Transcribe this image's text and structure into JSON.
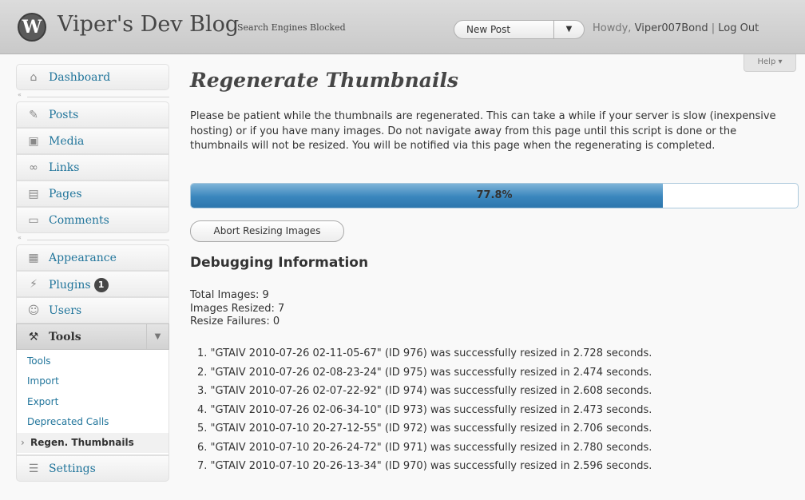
{
  "header": {
    "logo_glyph": "W",
    "site_title": "Viper's Dev Blog",
    "search_engines_notice": "Search Engines Blocked",
    "favorite_action": "New Post",
    "howdy": "Howdy,",
    "username": "Viper007Bond",
    "separator": "|",
    "logout": "Log Out"
  },
  "help_tab": "Help ▾",
  "sidebar": {
    "items": [
      {
        "label": "Dashboard",
        "icon": "home-icon",
        "glyph": "⌂"
      },
      {
        "label": "Posts",
        "icon": "pushpin-icon",
        "glyph": "✎"
      },
      {
        "label": "Media",
        "icon": "camera-icon",
        "glyph": "▣"
      },
      {
        "label": "Links",
        "icon": "chain-icon",
        "glyph": "∞"
      },
      {
        "label": "Pages",
        "icon": "pages-icon",
        "glyph": "▤"
      },
      {
        "label": "Comments",
        "icon": "speech-bubble-icon",
        "glyph": "▭"
      },
      {
        "label": "Appearance",
        "icon": "appearance-icon",
        "glyph": "▦"
      },
      {
        "label": "Plugins",
        "icon": "plug-icon",
        "glyph": "⚡",
        "badge": "1"
      },
      {
        "label": "Users",
        "icon": "users-icon",
        "glyph": "☺"
      },
      {
        "label": "Tools",
        "icon": "tools-icon",
        "glyph": "⚒"
      },
      {
        "label": "Settings",
        "icon": "settings-icon",
        "glyph": "☰"
      }
    ],
    "tools_submenu": [
      "Tools",
      "Import",
      "Export",
      "Deprecated Calls",
      "Regen. Thumbnails"
    ]
  },
  "main": {
    "title": "Regenerate Thumbnails",
    "intro": "Please be patient while the thumbnails are regenerated. This can take a while if your server is slow (inexpensive hosting) or if you have many images. Do not navigate away from this page until this script is done or the thumbnails will not be resized. You will be notified via this page when the regenerating is completed.",
    "progress": {
      "label": "77.8%",
      "fraction": 0.778
    },
    "abort_button": "Abort Resizing Images",
    "debug_title": "Debugging Information",
    "stats": [
      "Total Images: 9",
      "Images Resized: 7",
      "Resize Failures: 0"
    ],
    "log": [
      "1.  \"GTAIV 2010-07-26 02-11-05-67\" (ID 976) was successfully resized in 2.728 seconds.",
      "2.  \"GTAIV 2010-07-26 02-08-23-24\" (ID 975) was successfully resized in 2.474 seconds.",
      "3.  \"GTAIV 2010-07-26 02-07-22-92\" (ID 974) was successfully resized in 2.608 seconds.",
      "4.  \"GTAIV 2010-07-26 02-06-34-10\" (ID 973) was successfully resized in 2.473 seconds.",
      "5.  \"GTAIV 2010-07-10 20-27-12-55\" (ID 972) was successfully resized in 2.706 seconds.",
      "6.  \"GTAIV 2010-07-10 20-26-24-72\" (ID 971) was successfully resized in 2.780 seconds.",
      "7.  \"GTAIV 2010-07-10 20-26-13-34\" (ID 970) was successfully resized in 2.596 seconds."
    ]
  },
  "colors": {
    "link": "#21759b",
    "progress": "#3a86bd",
    "header_bg": "#d0d0d0"
  }
}
